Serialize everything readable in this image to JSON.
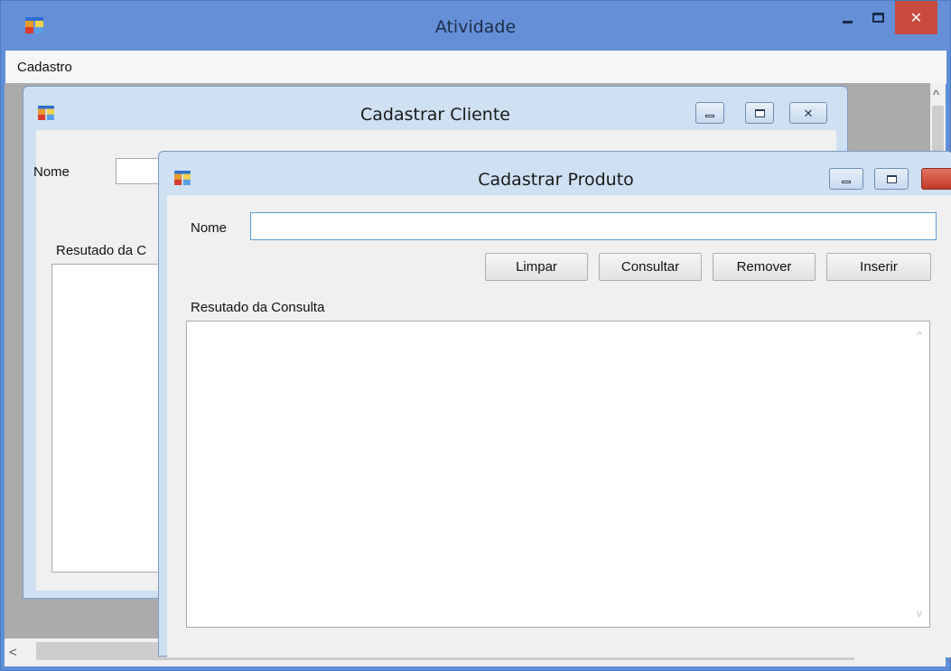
{
  "main_window": {
    "title": "Atividade",
    "close_glyph": "✕",
    "menu": {
      "cadastro": "Cadastro"
    }
  },
  "scrollbars": {
    "up": "^",
    "down": "v",
    "left": "<",
    "right": ">"
  },
  "cliente_window": {
    "title": "Cadastrar Cliente",
    "nome_label": "Nome",
    "nome_value": "",
    "result_label": "Resutado da C",
    "close_glyph": "✕"
  },
  "produto_window": {
    "title": "Cadastrar Produto",
    "nome_label": "Nome",
    "nome_value": "",
    "buttons": {
      "limpar": "Limpar",
      "consultar": "Consultar",
      "remover": "Remover",
      "inserir": "Inserir"
    },
    "result_label": "Resutado da Consulta",
    "result_value": ""
  },
  "colors": {
    "titlebar": "#6590d8",
    "close_button": "#c94b40",
    "mdi_background": "#ababab",
    "child_frame": "#cfe0f2",
    "input_focus_border": "#5b9bd5"
  },
  "icons": {
    "app": "app-form-icon",
    "minimize": "minimize-icon",
    "maximize": "maximize-icon",
    "close": "close-icon"
  }
}
